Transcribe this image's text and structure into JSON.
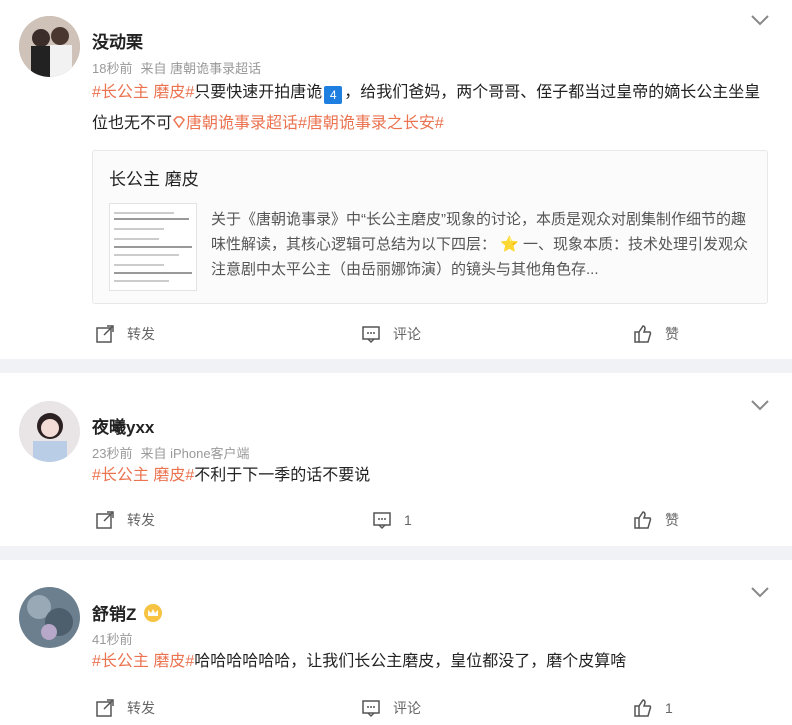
{
  "posts": [
    {
      "username": "没动栗",
      "time": "18秒前",
      "source": "来自 唐朝诡事录超话",
      "text": {
        "tag1": "#长公主 磨皮#",
        "body1": "只要快速开拍唐诡",
        "badge": "4",
        "body2": "，给我们爸妈，两个哥哥、侄子都当过皇帝的嫡长公主坐皇位也无不可",
        "tag2": "唐朝诡事录超话",
        "tag3": "#唐朝诡事录之长安#"
      },
      "card": {
        "title": "长公主 磨皮",
        "body": "关于《唐朝诡事录》中“长公主磨皮”现象的讨论，本质是观众对剧集制作细节的趣味性解读，其核心逻辑可总结为以下四层： ⭐ 一、现象本质：技术处理引发观众注意剧中太平公主（由岳丽娜饰演）的镜头与其他角色存..."
      },
      "actions": {
        "repost": "转发",
        "comment": "评论",
        "like": "赞"
      }
    },
    {
      "username": "夜曦yxx",
      "time": "23秒前",
      "source": "来自 iPhone客户端",
      "text": {
        "tag1": "#长公主 磨皮#",
        "body1": "不利于下一季的话不要说"
      },
      "actions": {
        "repost": "转发",
        "comment": "1",
        "like": "赞"
      }
    },
    {
      "username": "舒销Z",
      "time": "41秒前",
      "text": {
        "tag1": "#长公主 磨皮#",
        "body1": "哈哈哈哈哈哈，让我们长公主磨皮，皇位都没了，磨个皮算啥"
      },
      "actions": {
        "repost": "转发",
        "comment": "评论",
        "like": "1"
      }
    }
  ],
  "colors": {
    "tag": "#eb7350",
    "bg": "#f1f2f5",
    "text": "#222222"
  }
}
